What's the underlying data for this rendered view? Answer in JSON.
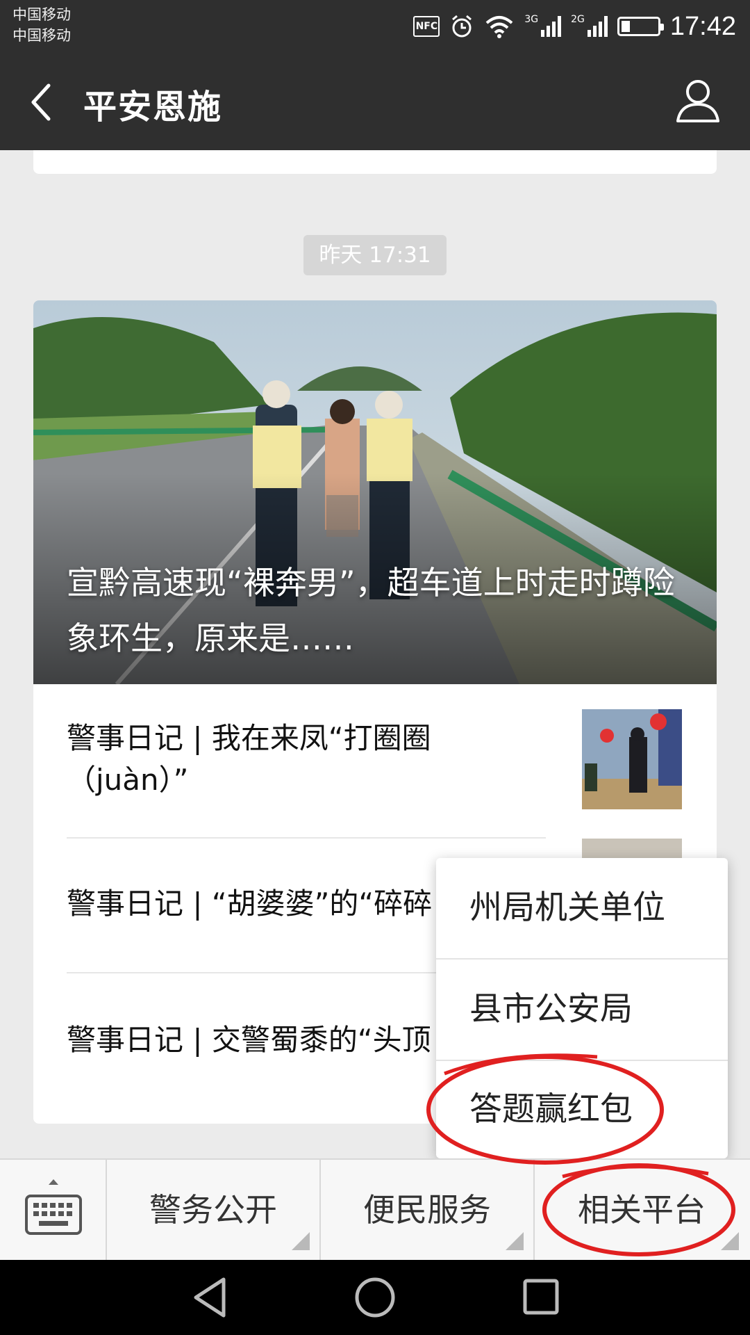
{
  "status_bar": {
    "carriers": [
      "中国移动",
      "中国移动"
    ],
    "nfc_label": "NFC",
    "net1": "3G",
    "net2": "2G",
    "battery_level": 0.25,
    "time": "17:42"
  },
  "header": {
    "title": "平安恩施",
    "back_icon": "chevron-left-icon",
    "profile_icon": "person-icon"
  },
  "message": {
    "timestamp": "昨天 17:31",
    "cover_title": "宣黔高速现“裸奔男”，超车道上时走时蹲险象环生，原来是……",
    "sub_articles": [
      {
        "title": "警事日记 | 我在来凤“打圈圈（juàn）”"
      },
      {
        "title": "警事日记 | “胡婆婆”的“碎碎"
      },
      {
        "title": "警事日记 | 交警蜀黍的“头顶"
      }
    ]
  },
  "popup_menu": {
    "items": [
      "州局机关单位",
      "县市公安局",
      "答题赢红包"
    ]
  },
  "bottom_menu": {
    "keyboard_icon": "keyboard-icon",
    "items": [
      "警务公开",
      "便民服务",
      "相关平台"
    ]
  },
  "colors": {
    "header_bg": "#2f2f2f",
    "page_bg": "#ebebeb",
    "annotation_red": "#e02020"
  }
}
